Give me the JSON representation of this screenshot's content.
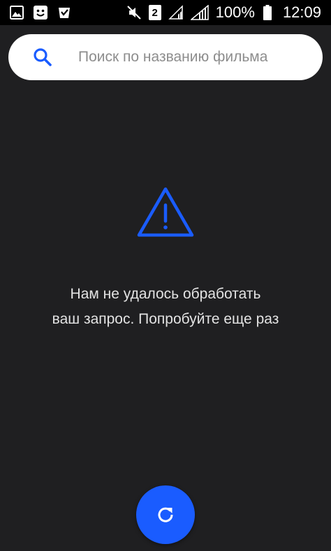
{
  "status_bar": {
    "battery_percent": "100%",
    "time": "12:09",
    "sim_slot": "2",
    "icons": [
      "gallery-icon",
      "smiley-icon",
      "check-bag-icon",
      "mute-icon",
      "sim-2-icon",
      "signal-icon",
      "signal-full-icon",
      "battery-icon"
    ]
  },
  "search": {
    "placeholder": "Поиск по названию фильма",
    "value": "",
    "icon": "search-icon"
  },
  "error": {
    "icon": "warning-triangle-icon",
    "line1": "Нам не удалось обработать",
    "line2": "ваш запрос. Попробуйте еще раз"
  },
  "refresh": {
    "icon": "refresh-icon"
  },
  "colors": {
    "background": "#1f1f21",
    "accent": "#1a5cff",
    "status_bar": "#000000",
    "search_bg": "#ffffff"
  }
}
